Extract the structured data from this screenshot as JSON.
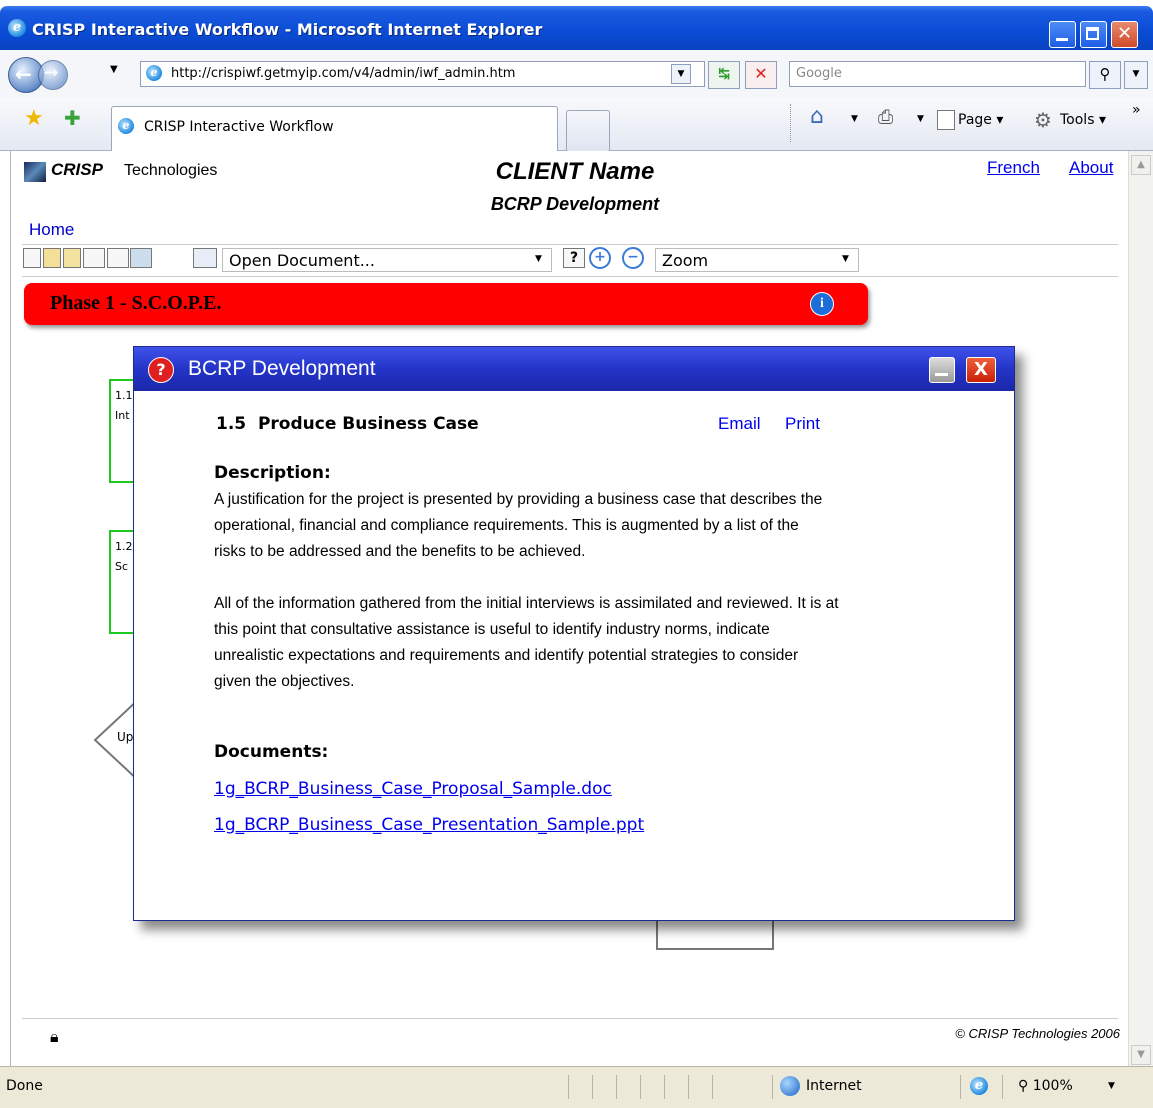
{
  "window": {
    "title": "CRISP Interactive Workflow - Microsoft Internet Explorer"
  },
  "navbar": {
    "address": "http://crispiwf.getmyip.com/v4/admin/iwf_admin.htm",
    "search_placeholder": "Google"
  },
  "tabbar": {
    "tab_title": "CRISP Interactive Workflow",
    "page_menu": "Page",
    "tools_menu": "Tools",
    "overflow": "»"
  },
  "site": {
    "logo_text": "CRISP",
    "logo_suffix": "Technologies",
    "client_name": "CLIENT Name",
    "subtitle": "BCRP Development",
    "french_link": "French",
    "about_link": "About",
    "home_link": "Home",
    "open_document": "Open Document...",
    "zoom": "Zoom",
    "phase_title": "Phase 1 - S.C.O.P.E.",
    "box1_num": "1.1",
    "box1_text": "Int",
    "box2_num": "1.2",
    "box2_text": "Sc",
    "diamond_text": "Up",
    "footer_copyright": "© CRISP Technologies 2006"
  },
  "dialog": {
    "title": "BCRP Development",
    "task_title": "1.5  Produce Business Case",
    "email_link": "Email",
    "print_link": "Print",
    "description_heading": "Description:",
    "description_p1_lines": [
      "A justification for the project is presented by providing a business case that describes the",
      "operational, financial and compliance requirements. This is augmented by a list of the",
      "risks to be addressed and the benefits to be achieved."
    ],
    "description_p2_lines": [
      "All of the information gathered from the initial interviews is assimilated and reviewed. It is at",
      "this point that consultative assistance is useful to identify industry norms, indicate",
      "unrealistic expectations and requirements and identify potential strategies to consider",
      "given the objectives."
    ],
    "documents_heading": "Documents:",
    "documents": [
      "1g_BCRP_Business_Case_Proposal_Sample.doc",
      "1g_BCRP_Business_Case_Presentation_Sample.ppt"
    ]
  },
  "statusbar": {
    "status_text": "Done",
    "zone": "Internet",
    "zoom_level": "100%"
  }
}
